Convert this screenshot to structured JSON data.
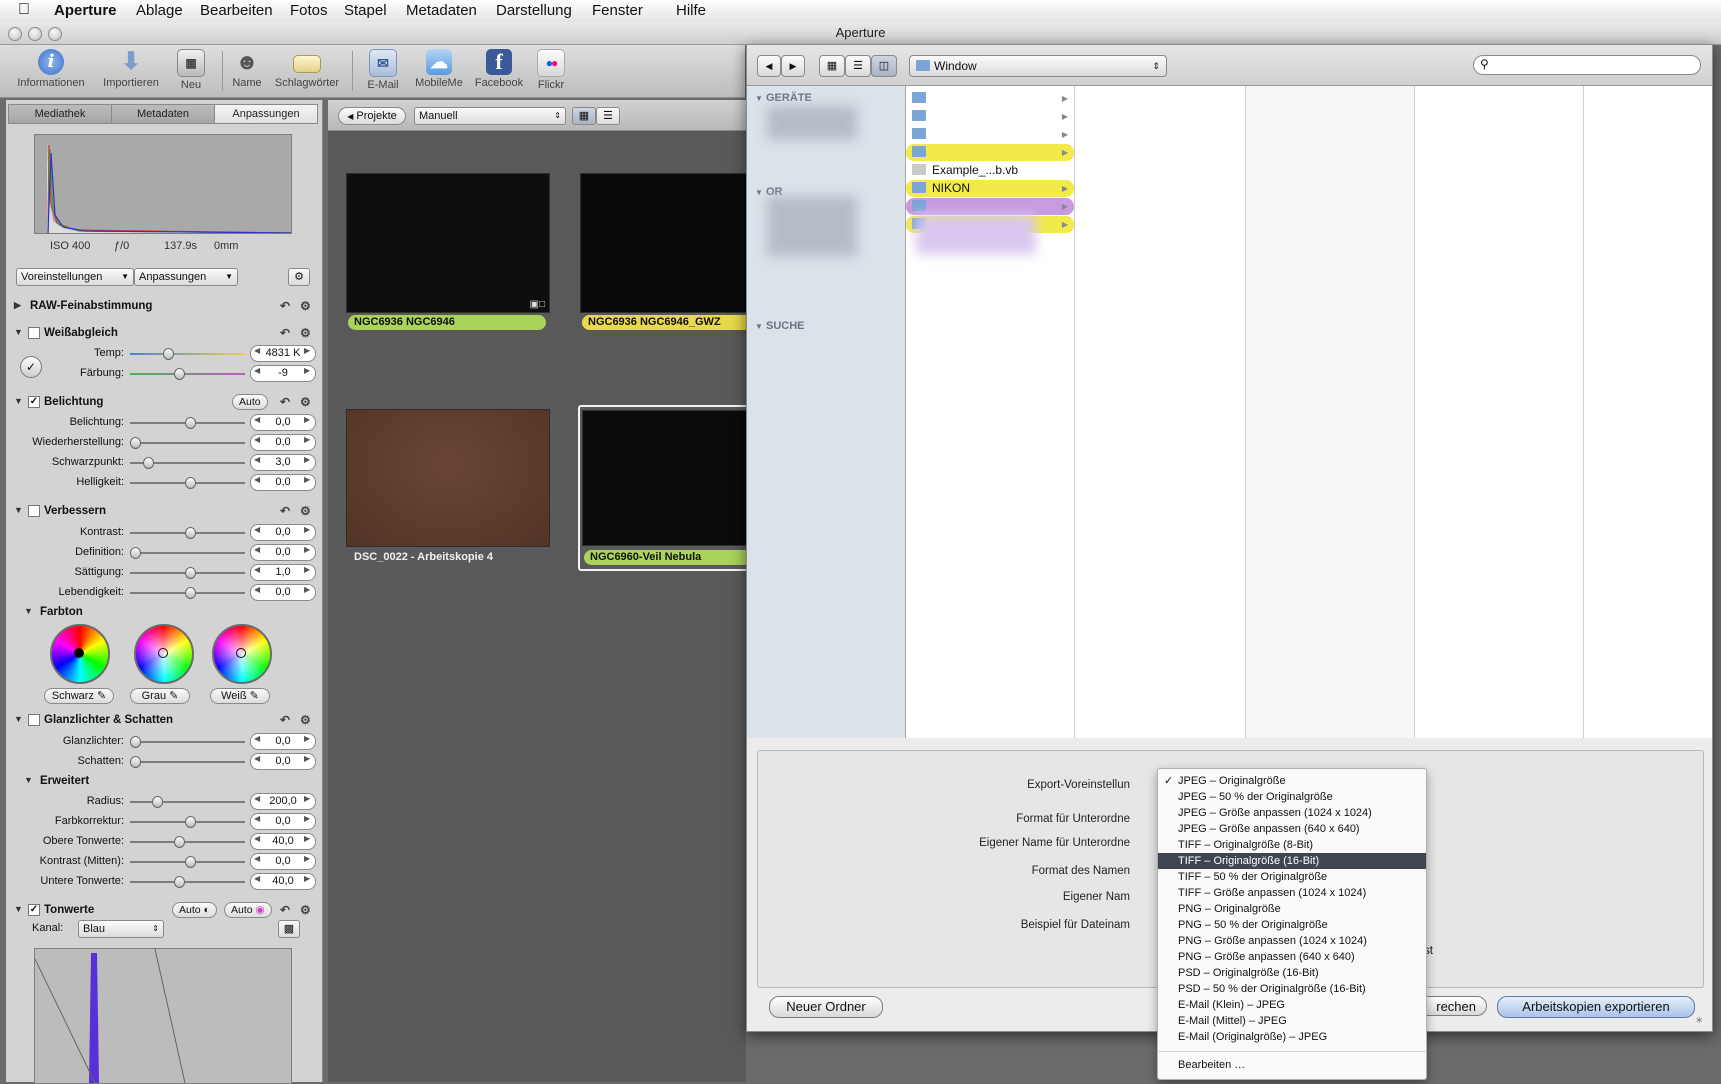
{
  "menubar": {
    "items": [
      "Aperture",
      "Ablage",
      "Bearbeiten",
      "Fotos",
      "Stapel",
      "Metadaten",
      "Darstellung",
      "Fenster",
      "Hilfe"
    ]
  },
  "window": {
    "title": "Aperture"
  },
  "toolbar": {
    "buttons": [
      {
        "label": "Informationen",
        "icon": "info-icon"
      },
      {
        "label": "Importieren",
        "icon": "import-icon"
      },
      {
        "label": "Neu",
        "icon": "new-icon"
      },
      {
        "label": "Name",
        "icon": "name-icon"
      },
      {
        "label": "Schlagwörter",
        "icon": "keywords-icon"
      },
      {
        "label": "E-Mail",
        "icon": "email-icon"
      },
      {
        "label": "MobileMe",
        "icon": "mobileme-icon"
      },
      {
        "label": "Facebook",
        "icon": "facebook-icon"
      },
      {
        "label": "Flickr",
        "icon": "flickr-icon"
      }
    ]
  },
  "inspector": {
    "tabs": [
      "Mediathek",
      "Metadaten",
      "Anpassungen"
    ],
    "exif": {
      "iso": "ISO 400",
      "aperture": "ƒ/0",
      "shutter": "137.9s",
      "focal": "0mm"
    },
    "presets_label": "Voreinstellungen",
    "adjustments_label": "Anpassungen",
    "raw": {
      "title": "RAW-Feinabstimmung"
    },
    "white_balance": {
      "title": "Weißabgleich",
      "temp_label": "Temp:",
      "temp_value": "4831 K",
      "temp_level": 0.3,
      "tint_label": "Färbung:",
      "tint_value": "-9",
      "tint_level": 0.4
    },
    "exposure": {
      "title": "Belichtung",
      "auto": "Auto",
      "rows": [
        {
          "label": "Belichtung:",
          "value": "0,0",
          "level": 0.5
        },
        {
          "label": "Wiederherstellung:",
          "value": "0,0",
          "level": 0.0
        },
        {
          "label": "Schwarzpunkt:",
          "value": "3,0",
          "level": 0.12
        },
        {
          "label": "Helligkeit:",
          "value": "0,0",
          "level": 0.5
        }
      ]
    },
    "enhance": {
      "title": "Verbessern",
      "rows": [
        {
          "label": "Kontrast:",
          "value": "0,0",
          "level": 0.5
        },
        {
          "label": "Definition:",
          "value": "0,0",
          "level": 0.0
        },
        {
          "label": "Sättigung:",
          "value": "1,0",
          "level": 0.5
        },
        {
          "label": "Lebendigkeit:",
          "value": "0,0",
          "level": 0.5
        }
      ],
      "tint_title": "Farbton",
      "wheels": [
        "Schwarz",
        "Grau",
        "Weiß"
      ]
    },
    "highlights": {
      "title": "Glanzlichter & Schatten",
      "rows": [
        {
          "label": "Glanzlichter:",
          "value": "0,0",
          "level": 0.0
        },
        {
          "label": "Schatten:",
          "value": "0,0",
          "level": 0.0
        }
      ],
      "advanced_title": "Erweitert",
      "advanced_rows": [
        {
          "label": "Radius:",
          "value": "200,0",
          "level": 0.2
        },
        {
          "label": "Farbkorrektur:",
          "value": "0,0",
          "level": 0.5
        },
        {
          "label": "Obere Tonwerte:",
          "value": "40,0",
          "level": 0.4
        },
        {
          "label": "Kontrast (Mitten):",
          "value": "0,0",
          "level": 0.5
        },
        {
          "label": "Untere Tonwerte:",
          "value": "40,0",
          "level": 0.4
        }
      ]
    },
    "levels": {
      "title": "Tonwerte",
      "auto1": "Auto",
      "auto2": "Auto",
      "channel_label": "Kanal:",
      "channel_value": "Blau"
    }
  },
  "browser": {
    "projects_button": "Projekte",
    "sort_value": "Manuell",
    "thumbs": [
      {
        "label": "NGC6936 NGC6946",
        "color": "#a9d35a"
      },
      {
        "label": "NGC6936 NGC6946_GWZ",
        "color": "#e7d94a"
      },
      {
        "label": "DSC_0022 - Arbeitskopie 4",
        "color": ""
      },
      {
        "label": "NGC6960-Veil Nebula",
        "color": "#a9d35a"
      }
    ]
  },
  "dialog": {
    "location": "Window",
    "search_placeholder": "",
    "sidebar": {
      "devices": "GERÄTE",
      "places": "OR",
      "search": "SUCHE"
    },
    "files": [
      {
        "name": "",
        "type": "folder",
        "highlight": ""
      },
      {
        "name": "",
        "type": "folder",
        "highlight": ""
      },
      {
        "name": "",
        "type": "folder",
        "highlight": ""
      },
      {
        "name": "",
        "type": "folder",
        "highlight": "#f2ea4a"
      },
      {
        "name": "Example_...b.vb",
        "type": "file",
        "highlight": ""
      },
      {
        "name": "NIKON",
        "type": "folder",
        "highlight": "#f2ea4a"
      },
      {
        "name": "",
        "type": "folder",
        "highlight": "#c89ae0"
      },
      {
        "name": "",
        "type": "folder",
        "highlight": "#f2ea4a"
      }
    ],
    "form": {
      "export_preset": "Export-Voreinstellun",
      "subfolder_format": "Format für Unterordne",
      "custom_subfolder": "Eigener Name für Unterordne",
      "name_format": "Format des Namen",
      "custom_name": "Eigener Nam",
      "example": "Beispiel für Dateinam",
      "hint": "ssen ist"
    },
    "new_folder": "Neuer Ordner",
    "cancel": "rechen",
    "export": "Arbeitskopien exportieren"
  },
  "dropdown": {
    "items": [
      "JPEG – Originalgröße",
      "JPEG – 50 % der Originalgröße",
      "JPEG – Größe anpassen (1024 x 1024)",
      "JPEG – Größe anpassen (640 x 640)",
      "TIFF – Originalgröße (8-Bit)",
      "TIFF – Originalgröße (16-Bit)",
      "TIFF – 50 % der Originalgröße",
      "TIFF – Größe anpassen (1024 x 1024)",
      "PNG – Originalgröße",
      "PNG – 50 % der Originalgröße",
      "PNG – Größe anpassen (1024 x 1024)",
      "PNG – Größe anpassen (640 x 640)",
      "PSD – Originalgröße (16-Bit)",
      "PSD – 50 % der Originalgröße (16-Bit)",
      "E-Mail (Klein) – JPEG",
      "E-Mail (Mittel) – JPEG",
      "E-Mail (Originalgröße) – JPEG"
    ],
    "checked_index": 0,
    "highlighted_index": 5,
    "edit_label": "Bearbeiten …",
    "check_mark": "✓"
  }
}
